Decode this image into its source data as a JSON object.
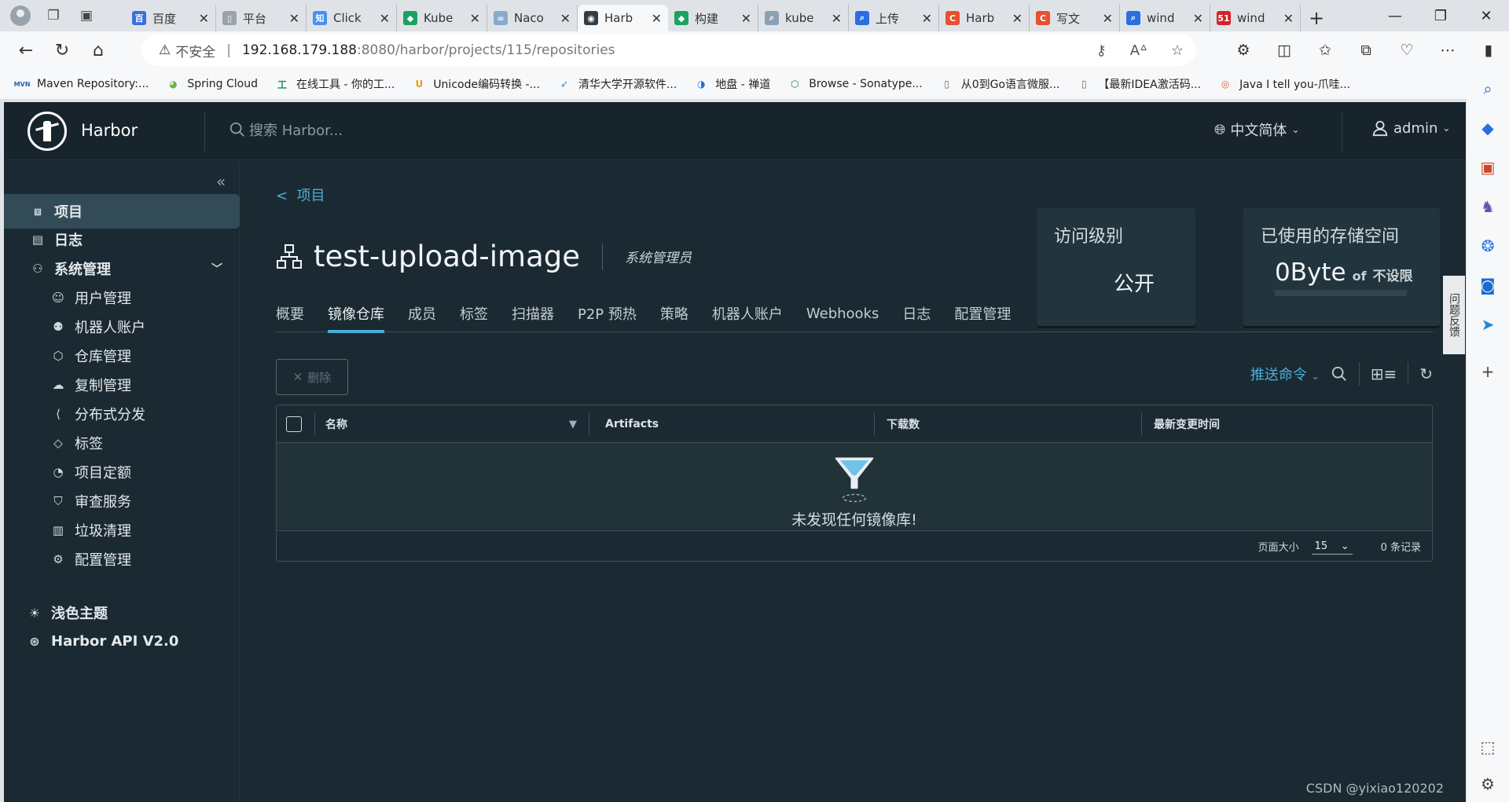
{
  "browser": {
    "tabs": [
      {
        "title": "百度",
        "color": "#3b6fe0",
        "glyph": "百"
      },
      {
        "title": "平台",
        "color": "#9aa3ad",
        "glyph": "▯"
      },
      {
        "title": "Click",
        "color": "#4a8ff0",
        "glyph": "知"
      },
      {
        "title": "Kube",
        "color": "#1aa260",
        "glyph": "◆"
      },
      {
        "title": "Naco",
        "color": "#88aacc",
        "glyph": "∞"
      },
      {
        "title": "Harb",
        "color": "#2f3d45",
        "glyph": "◉"
      },
      {
        "title": "构建",
        "color": "#1aa260",
        "glyph": "◆"
      },
      {
        "title": "kube",
        "color": "#8aa0b4",
        "glyph": "⌕"
      },
      {
        "title": "上传",
        "color": "#2a6ee0",
        "glyph": "⌕"
      },
      {
        "title": "Harb",
        "color": "#e8502e",
        "glyph": "C"
      },
      {
        "title": "写文",
        "color": "#e8502e",
        "glyph": "C"
      },
      {
        "title": "wind",
        "color": "#2a6ee0",
        "glyph": "⌕"
      },
      {
        "title": "wind",
        "color": "#d4222b",
        "glyph": "51"
      }
    ],
    "active_tab_index": 5,
    "address": {
      "insecure_label": "不安全",
      "host": "192.168.179.188",
      "path": ":8080/harbor/projects/115/repositories"
    },
    "bookmarks": [
      {
        "label": "Maven Repository:...",
        "glyph": "MVN",
        "color": "#2266aa"
      },
      {
        "label": "Spring Cloud",
        "glyph": "◕",
        "color": "#6db33f"
      },
      {
        "label": "在线工具 - 你的工...",
        "glyph": "工",
        "color": "#1f8a5b"
      },
      {
        "label": "Unicode编码转换 -...",
        "glyph": "U",
        "color": "#e0a020"
      },
      {
        "label": "清华大学开源软件...",
        "glyph": "➶",
        "color": "#2c8ad8"
      },
      {
        "label": "地盘 - 禅道",
        "glyph": "◑",
        "color": "#1a73d8"
      },
      {
        "label": "Browse - Sonatype...",
        "glyph": "⬡",
        "color": "#2a7a3a"
      },
      {
        "label": "从0到Go语言微服...",
        "glyph": "▯",
        "color": "#666666"
      },
      {
        "label": "【最新IDEA激活码...",
        "glyph": "▯",
        "color": "#666666"
      },
      {
        "label": "Java I tell you-爪哇...",
        "glyph": "◎",
        "color": "#e06030"
      }
    ]
  },
  "app": {
    "brand": "Harbor",
    "search_placeholder": "搜索 Harbor...",
    "language": "中文简体",
    "user": "admin",
    "sidebar": {
      "items": [
        {
          "label": "项目",
          "name": "projects"
        },
        {
          "label": "日志",
          "name": "logs"
        },
        {
          "label": "系统管理",
          "name": "administration"
        }
      ],
      "sub_items": [
        {
          "label": "用户管理",
          "name": "user-management"
        },
        {
          "label": "机器人账户",
          "name": "robot-accounts"
        },
        {
          "label": "仓库管理",
          "name": "registries"
        },
        {
          "label": "复制管理",
          "name": "replications"
        },
        {
          "label": "分布式分发",
          "name": "distributions"
        },
        {
          "label": "标签",
          "name": "labels"
        },
        {
          "label": "项目定额",
          "name": "project-quotas"
        },
        {
          "label": "审查服务",
          "name": "interrogation-services"
        },
        {
          "label": "垃圾清理",
          "name": "garbage-collection"
        },
        {
          "label": "配置管理",
          "name": "configuration"
        }
      ],
      "theme_label": "浅色主题",
      "api_label": "Harbor API V2.0"
    },
    "project": {
      "back_label": "项目",
      "name": "test-upload-image",
      "role": "系统管理员",
      "access_card": {
        "title": "访问级别",
        "value": "公开"
      },
      "storage_card": {
        "title": "已使用的存储空间",
        "used": "0Byte",
        "of": "of",
        "limit": "不设限",
        "used_fraction": 0
      }
    },
    "tabs": [
      "概要",
      "镜像仓库",
      "成员",
      "标签",
      "扫描器",
      "P2P 预热",
      "策略",
      "机器人账户",
      "Webhooks",
      "日志",
      "配置管理"
    ],
    "active_tab_index": 1,
    "delete_label": "删除",
    "push_command_label": "推送命令",
    "table": {
      "columns": [
        "名称",
        "Artifacts",
        "下载数",
        "最新变更时间"
      ],
      "empty_text": "未发现任何镜像库!",
      "page_size_label": "页面大小",
      "page_size": "15",
      "total_label": "0 条记录"
    },
    "feedback_label": "问题反馈",
    "watermark": "CSDN @yixiao120202"
  }
}
